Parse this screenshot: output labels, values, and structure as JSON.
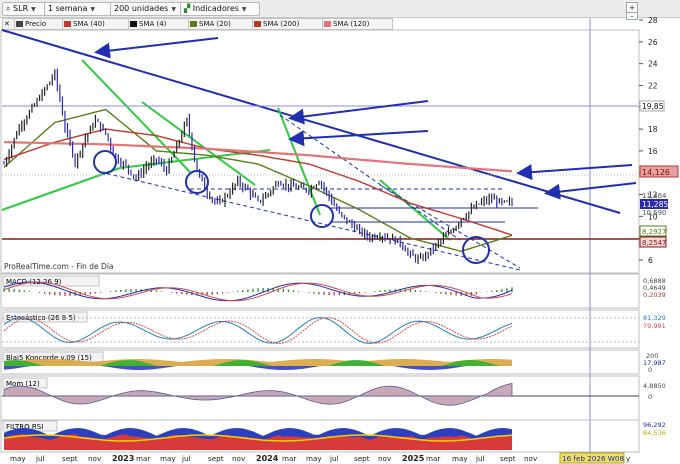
{
  "toolbar": {
    "ticker": "SLR",
    "period": "1 semana",
    "units": "200 unidades",
    "indicators": "Indicadores"
  },
  "legend": [
    {
      "label": "Precio",
      "color": "#333333"
    },
    {
      "label": "SMA (40)",
      "color": "#c0392b"
    },
    {
      "label": "SMA (4)",
      "color": "#111111"
    },
    {
      "label": "SMA (20)",
      "color": "#5a7d1a"
    },
    {
      "label": "SMA (200)",
      "color": "#b03a2e"
    },
    {
      "label": "SMA (120)",
      "color": "#e4737a"
    }
  ],
  "icons": {
    "close": "close-icon",
    "add": "add-icon",
    "minimize": "minimize-icon"
  },
  "watermark": "ProRealTime.com - Fin de Día",
  "colors": {
    "price_down": "#2b2ba8",
    "support_red": "#8b1a1a",
    "trend_green": "#2ecc40",
    "trend_blue": "#1f2fb0",
    "current_price": "#2b2ba8"
  },
  "chart_data": [
    {
      "type": "line",
      "name": "price",
      "title": "",
      "ylim": [
        5.5,
        28.5
      ],
      "yticks": [
        6,
        8,
        10,
        12,
        14,
        16,
        18,
        20,
        22,
        24,
        26,
        28
      ],
      "x_labels": [
        "may",
        "jul",
        "sept",
        "nov",
        "2023",
        "mar",
        "may",
        "jul",
        "sept",
        "nov",
        "2024",
        "mar",
        "may",
        "jul",
        "sept",
        "nov",
        "2025",
        "mar",
        "may",
        "jul",
        "sept",
        "nov",
        "16 feb 2026 W08",
        "y"
      ],
      "series": [
        {
          "name": "Precio",
          "x": [
            0,
            6,
            12,
            16,
            20,
            24,
            28,
            32,
            36,
            40,
            44,
            48,
            52,
            56,
            60,
            64,
            68,
            72,
            76,
            80,
            84,
            88,
            92,
            96,
            100,
            104,
            108,
            112,
            116,
            120,
            124,
            128,
            132,
            136,
            140,
            144,
            148,
            152,
            156,
            160,
            164,
            168,
            172,
            176,
            180,
            184,
            188,
            192,
            196,
            200
          ],
          "values": [
            14.8,
            18.2,
            20.2,
            21.6,
            23.1,
            18.2,
            15.0,
            17.2,
            18.8,
            17.6,
            15.4,
            14.6,
            13.5,
            14.6,
            15.2,
            14.2,
            16.4,
            18.8,
            14.2,
            12.2,
            11.1,
            12.0,
            13.2,
            12.4,
            11.3,
            12.1,
            13.2,
            12.8,
            12.6,
            12.4,
            13.3,
            11.8,
            10.2,
            9.4,
            8.6,
            8.1,
            8.3,
            8.0,
            7.6,
            6.4,
            6.0,
            6.9,
            7.8,
            8.6,
            9.8,
            10.6,
            11.3,
            11.6,
            11.2,
            11.28
          ]
        },
        {
          "name": "SMA (20)",
          "x": [
            0,
            20,
            40,
            60,
            80,
            100,
            120,
            140,
            160,
            180,
            200
          ],
          "values": [
            14.5,
            18.6,
            19.8,
            16.0,
            15.6,
            14.8,
            12.8,
            10.6,
            8.0,
            6.8,
            8.25
          ]
        },
        {
          "name": "SMA (40)",
          "x": [
            0,
            20,
            40,
            60,
            80,
            100,
            120,
            140,
            160,
            180,
            200
          ],
          "values": [
            15.2,
            16.8,
            18.0,
            17.4,
            16.2,
            15.6,
            14.8,
            13.2,
            11.2,
            9.8,
            8.29
          ]
        },
        {
          "name": "SMA (120)",
          "x": [
            0,
            40,
            80,
            120,
            160,
            200
          ],
          "values": [
            16.8,
            16.6,
            16.2,
            15.6,
            14.8,
            14.13
          ]
        },
        {
          "name": "SMA (200)",
          "x": [
            0,
            200
          ],
          "values": [
            8.25,
            8.25
          ]
        }
      ],
      "price_labels": [
        "19,85",
        "14,126",
        "11,464",
        "11,285",
        "10,690",
        "8,2927",
        "8,2547"
      ],
      "current_price": 11.285
    },
    {
      "type": "line",
      "name": "MACD (12 26 9)",
      "price_labels": [
        "0,6888",
        "0,4649",
        "0,2039"
      ]
    },
    {
      "type": "line",
      "name": "Estocástico (26 8 5)",
      "price_labels": [
        "81,329",
        "79,991"
      ]
    },
    {
      "type": "area",
      "name": "Blai5 Koncorde v.09 (15)",
      "yticks": [
        200,
        0
      ],
      "price_labels": [
        "17,987"
      ]
    },
    {
      "type": "area",
      "name": "Mom (12)",
      "price_labels": [
        "4,8850"
      ],
      "yticks": [
        0
      ]
    },
    {
      "type": "area",
      "name": "FILTRO RSI",
      "price_labels": [
        "96,292",
        "84,536"
      ]
    }
  ]
}
